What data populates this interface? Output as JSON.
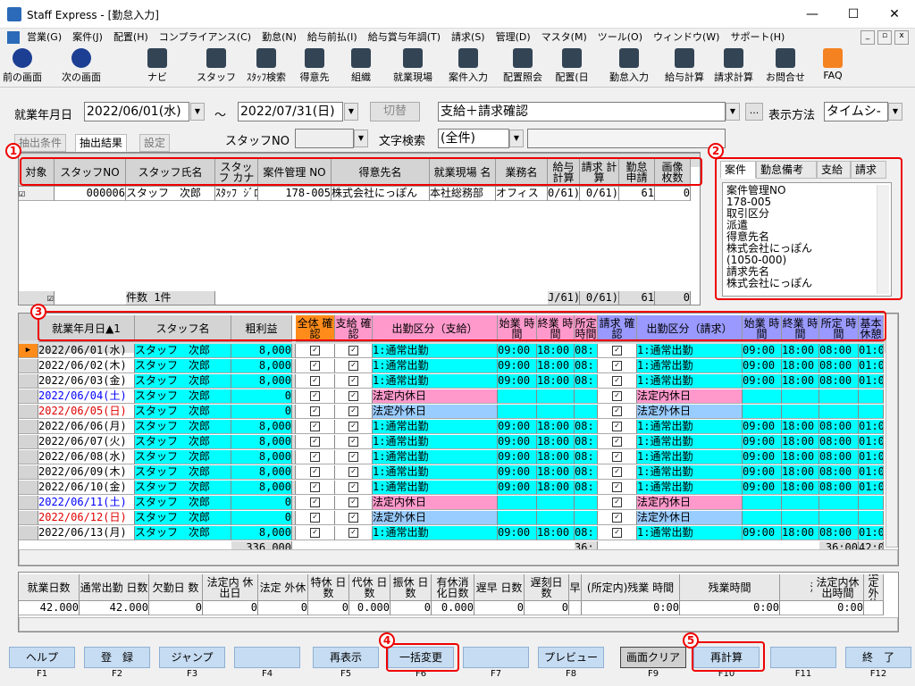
{
  "window": {
    "title": "Staff Express - [勤怠入力]"
  },
  "menu": [
    "営業(G)",
    "案件(J)",
    "配置(H)",
    "コンプライアンス(C)",
    "勤怠(N)",
    "給与前払(I)",
    "給与賞与年調(T)",
    "請求(S)",
    "管理(D)",
    "マスタ(M)",
    "ツール(O)",
    "ウィンドウ(W)",
    "サポート(H)"
  ],
  "toolbar": [
    "前の画面",
    "次の画面",
    "ナビ",
    "スタッフ",
    "ｽﾀｯﾌ検索",
    "得意先",
    "組織",
    "就業現場",
    "案件入力",
    "配置照会",
    "配置(日",
    "勤怠入力",
    "給与計算",
    "請求計算",
    "お問合せ",
    "FAQ"
  ],
  "filter": {
    "label_period": "就業年月日",
    "date_from": "2022/06/01(水)",
    "tilde": "～",
    "date_to": "2022/07/31(日)",
    "switch": "切替",
    "mode": "支給＋請求確認",
    "ellipsis": "...",
    "display_label": "表示方法",
    "display_value": "タイムシ-",
    "staff_label": "スタッフNO",
    "text_search_label": "文字検索",
    "text_search_value": "(全件)"
  },
  "tabs": {
    "extract_cond": "抽出条件",
    "extract_result": "抽出結果",
    "settings": "設定"
  },
  "upper": {
    "headers": [
      "対象",
      "スタッフNO",
      "スタッフ氏名",
      "スタッフ カナ",
      "案件管理 NO",
      "得意先名",
      "就業現場 名",
      "業務名",
      "給与 計算",
      "請求 計算",
      "勤怠 申請",
      "画像 枚数"
    ],
    "row": [
      "☑",
      "000006",
      "スタッフ　次郎",
      "ｽﾀｯﾌ ｼﾞﾛｳ",
      "178-005",
      "株式会社にっぽん",
      "本社総務部",
      "オフィス",
      "0/61)",
      "0/61)",
      "61",
      "0"
    ],
    "footer": [
      "☑",
      "件数 1件",
      "J/61)",
      "0/61)",
      "61",
      "0"
    ]
  },
  "right_tabs": [
    "案件",
    "勤怠備考",
    "支給",
    "請求"
  ],
  "detail": [
    "案件管理NO",
    "178-005",
    "取引区分",
    "派遣",
    "得意先名",
    "株式会社にっぽん",
    "(1050-000)",
    "請求先名",
    "株式会社にっぽん"
  ],
  "lower": {
    "headers": [
      "就業年月日▲1",
      "スタッフ名",
      "粗利益",
      "全体 確認",
      "支給 確認",
      "出勤区分（支給）",
      "始業 時間",
      "終業 時間",
      "所定 時間",
      "請求 確認",
      "出勤区分（請求）",
      "始業 時間",
      "終業 時間",
      "所定 時間",
      "基本 休憩"
    ],
    "rows": [
      {
        "d": "2022/06/01(水)",
        "n": "スタッフ　次郎",
        "p": "8,000",
        "k": "1:通常出勤",
        "s": "09:00",
        "e": "18:00",
        "h": "08:",
        "k2": "1:通常出勤",
        "s2": "09:00",
        "e2": "18:00",
        "h2": "08:00",
        "b": "01:0",
        "c": "#000",
        "t": "w"
      },
      {
        "d": "2022/06/02(木)",
        "n": "スタッフ　次郎",
        "p": "8,000",
        "k": "1:通常出勤",
        "s": "09:00",
        "e": "18:00",
        "h": "08:",
        "k2": "1:通常出勤",
        "s2": "09:00",
        "e2": "18:00",
        "h2": "08:00",
        "b": "01:0",
        "c": "#000",
        "t": "w"
      },
      {
        "d": "2022/06/03(金)",
        "n": "スタッフ　次郎",
        "p": "8,000",
        "k": "1:通常出勤",
        "s": "09:00",
        "e": "18:00",
        "h": "08:",
        "k2": "1:通常出勤",
        "s2": "09:00",
        "e2": "18:00",
        "h2": "08:00",
        "b": "01:0",
        "c": "#000",
        "t": "w"
      },
      {
        "d": "2022/06/04(土)",
        "n": "スタッフ　次郎",
        "p": "0",
        "k": "法定内休日",
        "s": "",
        "e": "",
        "h": "",
        "k2": "法定内休日",
        "s2": "",
        "e2": "",
        "h2": "",
        "b": "",
        "c": "#0000ff",
        "t": "p"
      },
      {
        "d": "2022/06/05(日)",
        "n": "スタッフ　次郎",
        "p": "0",
        "k": "法定外休日",
        "s": "",
        "e": "",
        "h": "",
        "k2": "法定外休日",
        "s2": "",
        "e2": "",
        "h2": "",
        "b": "",
        "c": "#e00000",
        "t": "b"
      },
      {
        "d": "2022/06/06(月)",
        "n": "スタッフ　次郎",
        "p": "8,000",
        "k": "1:通常出勤",
        "s": "09:00",
        "e": "18:00",
        "h": "08:",
        "k2": "1:通常出勤",
        "s2": "09:00",
        "e2": "18:00",
        "h2": "08:00",
        "b": "01:0",
        "c": "#000",
        "t": "w"
      },
      {
        "d": "2022/06/07(火)",
        "n": "スタッフ　次郎",
        "p": "8,000",
        "k": "1:通常出勤",
        "s": "09:00",
        "e": "18:00",
        "h": "08:",
        "k2": "1:通常出勤",
        "s2": "09:00",
        "e2": "18:00",
        "h2": "08:00",
        "b": "01:0",
        "c": "#000",
        "t": "w"
      },
      {
        "d": "2022/06/08(水)",
        "n": "スタッフ　次郎",
        "p": "8,000",
        "k": "1:通常出勤",
        "s": "09:00",
        "e": "18:00",
        "h": "08:",
        "k2": "1:通常出勤",
        "s2": "09:00",
        "e2": "18:00",
        "h2": "08:00",
        "b": "01:0",
        "c": "#000",
        "t": "w"
      },
      {
        "d": "2022/06/09(木)",
        "n": "スタッフ　次郎",
        "p": "8,000",
        "k": "1:通常出勤",
        "s": "09:00",
        "e": "18:00",
        "h": "08:",
        "k2": "1:通常出勤",
        "s2": "09:00",
        "e2": "18:00",
        "h2": "08:00",
        "b": "01:0",
        "c": "#000",
        "t": "w"
      },
      {
        "d": "2022/06/10(金)",
        "n": "スタッフ　次郎",
        "p": "8,000",
        "k": "1:通常出勤",
        "s": "09:00",
        "e": "18:00",
        "h": "08:",
        "k2": "1:通常出勤",
        "s2": "09:00",
        "e2": "18:00",
        "h2": "08:00",
        "b": "01:0",
        "c": "#000",
        "t": "w"
      },
      {
        "d": "2022/06/11(土)",
        "n": "スタッフ　次郎",
        "p": "0",
        "k": "法定内休日",
        "s": "",
        "e": "",
        "h": "",
        "k2": "法定内休日",
        "s2": "",
        "e2": "",
        "h2": "",
        "b": "",
        "c": "#0000ff",
        "t": "p"
      },
      {
        "d": "2022/06/12(日)",
        "n": "スタッフ　次郎",
        "p": "0",
        "k": "法定外休日",
        "s": "",
        "e": "",
        "h": "",
        "k2": "法定外休日",
        "s2": "",
        "e2": "",
        "h2": "",
        "b": "",
        "c": "#e00000",
        "t": "b"
      },
      {
        "d": "2022/06/13(月)",
        "n": "スタッフ　次郎",
        "p": "8,000",
        "k": "1:通常出勤",
        "s": "09:00",
        "e": "18:00",
        "h": "08:",
        "k2": "1:通常出勤",
        "s2": "09:00",
        "e2": "18:00",
        "h2": "08:00",
        "b": "01:0",
        "c": "#000",
        "t": "w"
      }
    ],
    "total": {
      "p": "336,000",
      "h": "36:",
      "h2": "36:00",
      "b": "42:0"
    }
  },
  "summary": {
    "headers": [
      "就業日数",
      "通常出勤 日数",
      "欠勤日 数",
      "法定内 休出日",
      "法定 外休",
      "特休 日数",
      "代休 日数",
      "振休 日数",
      "有休消 化日数",
      "遅早 日数",
      "遅刻日 数",
      "早",
      "(所定内)残業 時間",
      "残業時間",
      "深夜時間",
      "法定内休 出時間",
      "法定 外休"
    ],
    "values": [
      "42.000",
      "42.000",
      "0",
      "0",
      "0",
      "0",
      "0.000",
      "0",
      "0.000",
      "0",
      "0",
      "",
      "0:00",
      "0:00",
      "0:00",
      "0:00",
      ""
    ]
  },
  "fkeys": [
    {
      "label": "ヘルプ",
      "key": "F1"
    },
    {
      "label": "登　録",
      "key": "F2"
    },
    {
      "label": "ジャンプ",
      "key": "F3"
    },
    {
      "label": "",
      "key": "F4"
    },
    {
      "label": "再表示",
      "key": "F5"
    },
    {
      "label": "一括変更",
      "key": "F6"
    },
    {
      "label": "",
      "key": "F7"
    },
    {
      "label": "プレビュー",
      "key": "F8"
    },
    {
      "label": "画面クリア",
      "key": "F9"
    },
    {
      "label": "再計算",
      "key": "F10"
    },
    {
      "label": "",
      "key": "F11"
    },
    {
      "label": "終　了",
      "key": "F12"
    }
  ],
  "markers": [
    "1",
    "2",
    "3",
    "4",
    "5"
  ],
  "colors": {
    "cyan": "#00ffff",
    "pink": "#ff99cc",
    "blue": "#99ccff",
    "header_orange": "#ff8c1a",
    "header_pink": "#ff99cc",
    "header_purple": "#9999ff"
  }
}
